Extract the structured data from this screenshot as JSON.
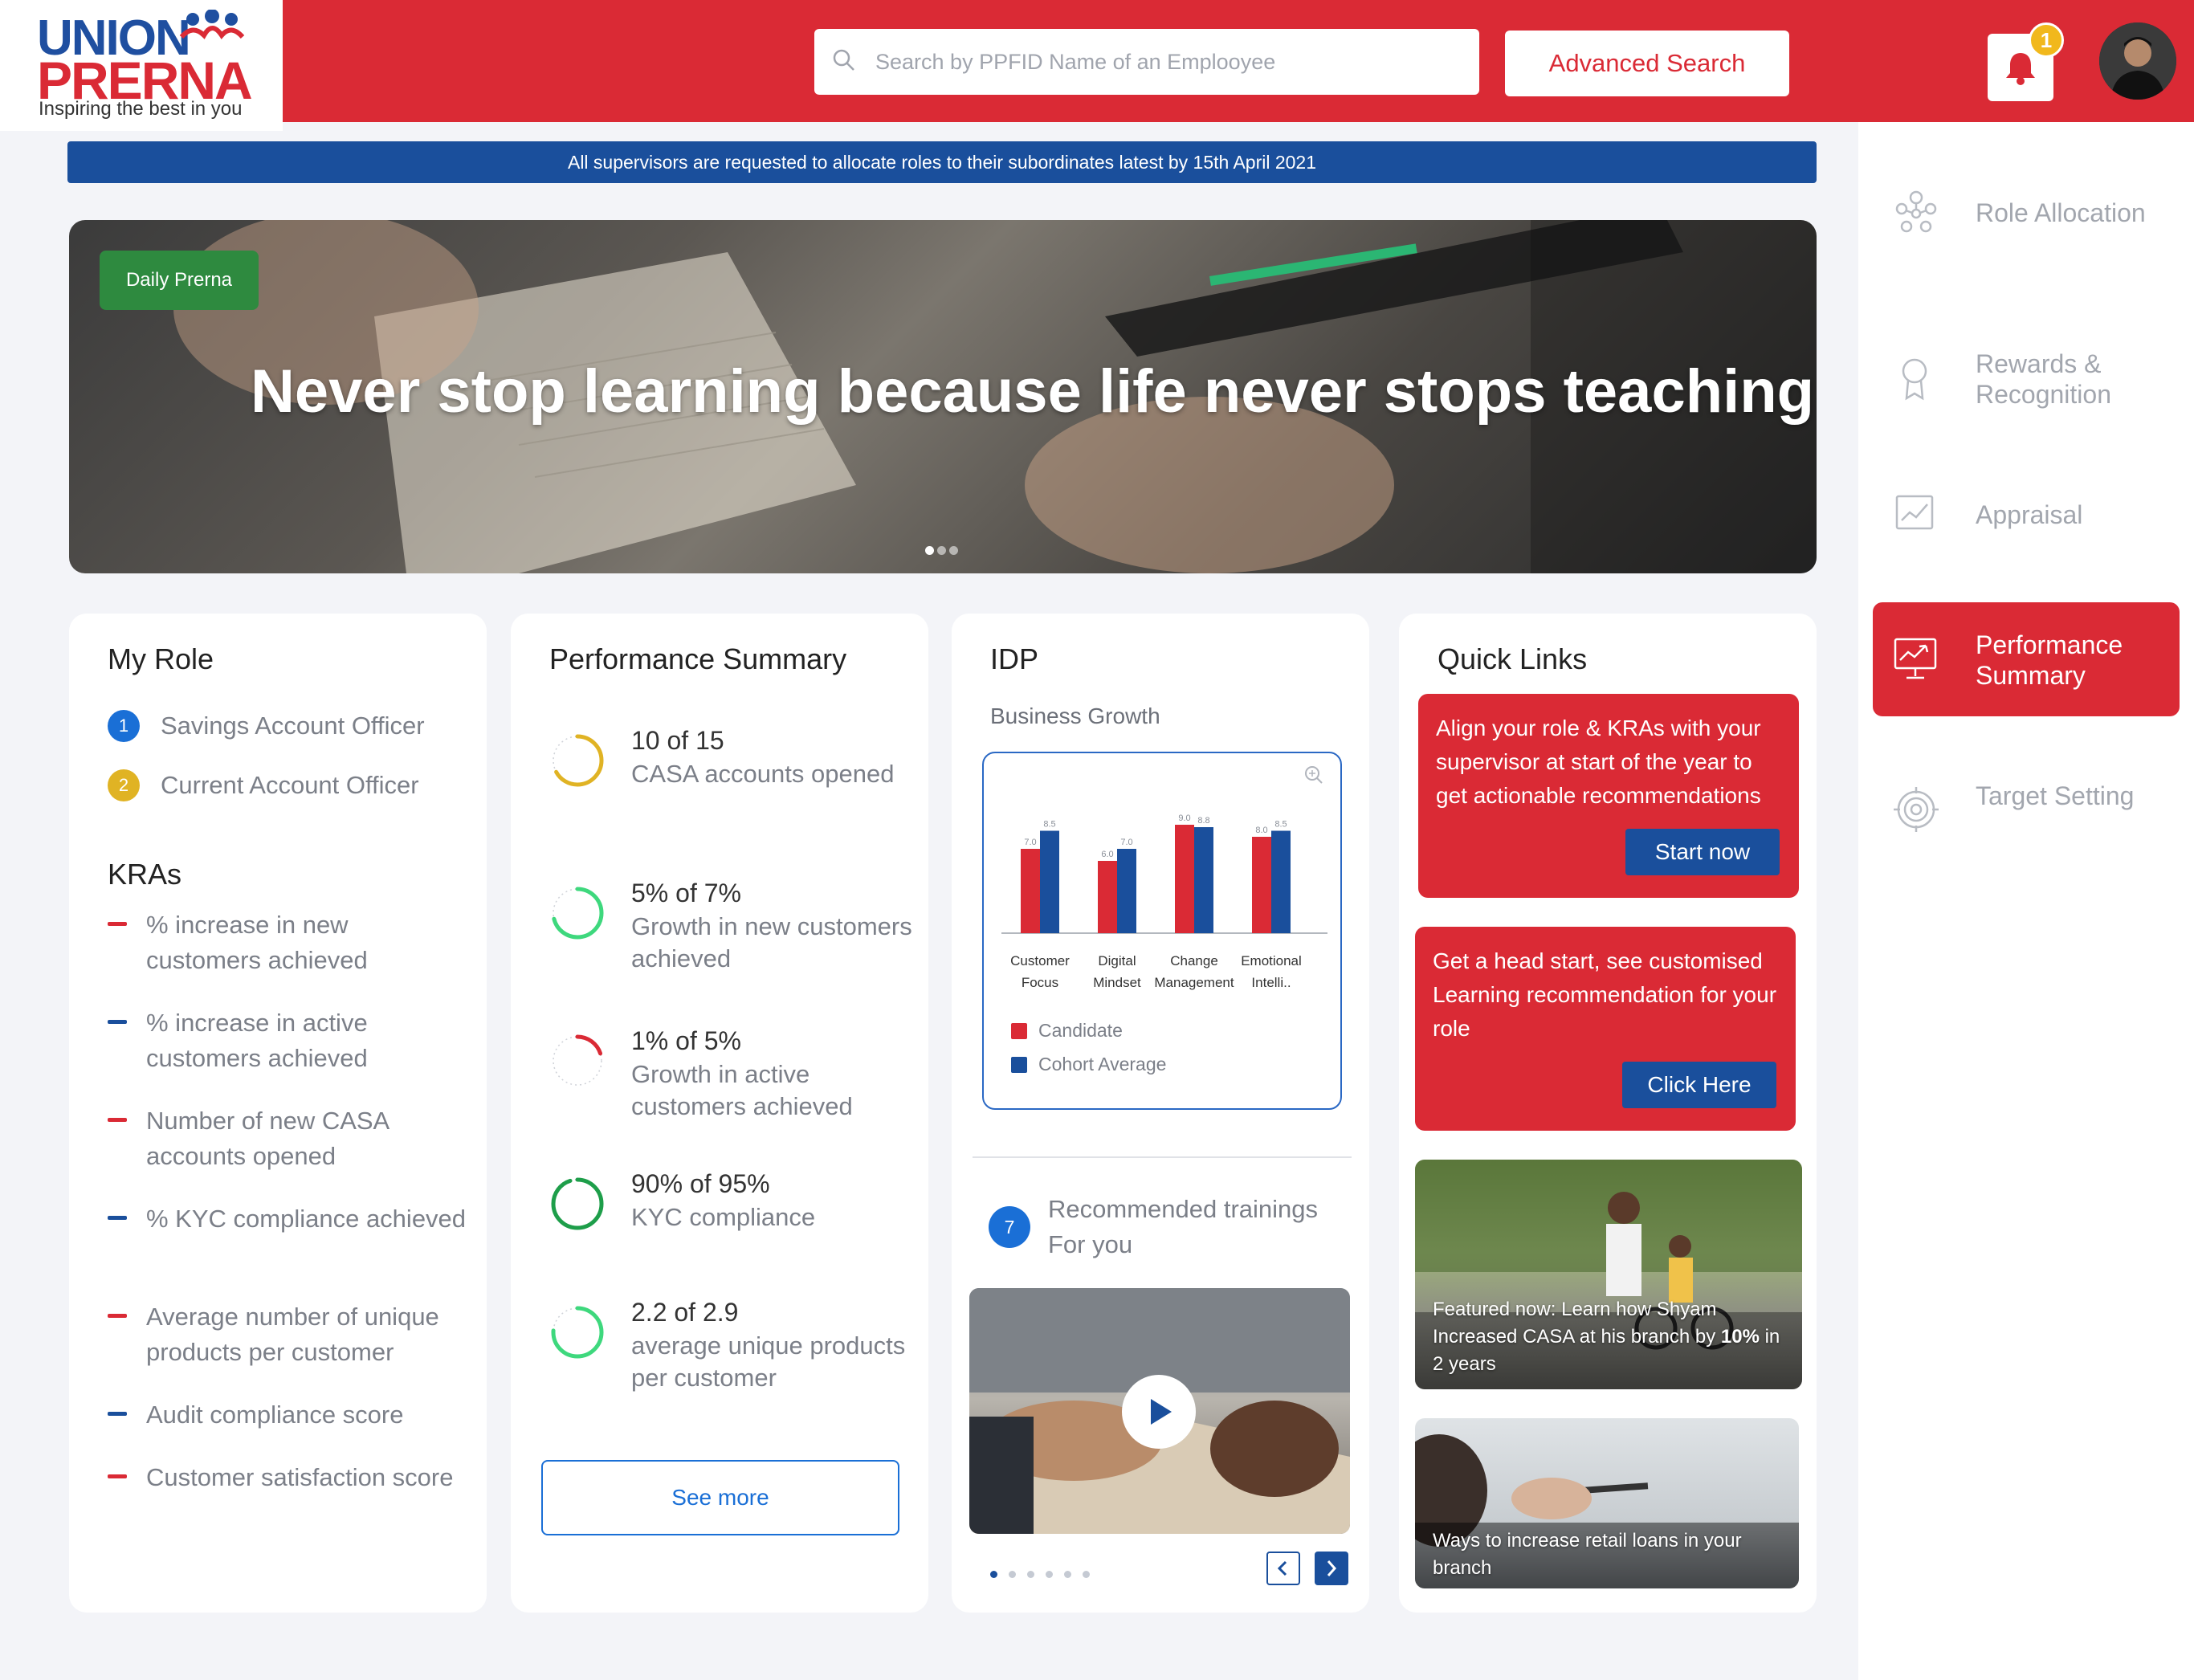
{
  "header": {
    "logo_top": "UNION",
    "logo_bottom": "PRERNA",
    "logo_tagline": "Inspiring the best in you",
    "search_placeholder": "Search by PPFID Name of an Emplooyee",
    "advanced_search_label": "Advanced Search",
    "notification_count": "1",
    "brand_color": "#da2a35",
    "accent_color": "#1a4f9c"
  },
  "notice": "All supervisors are requested to allocate roles to their subordinates latest by 15th April 2021",
  "hero": {
    "badge": "Daily Prerna",
    "quote": "Never stop learning because life never stops teaching",
    "slides": 3,
    "active_slide": 1
  },
  "my_role": {
    "title": "My Role",
    "roles": [
      {
        "num": "1",
        "label": "Savings Account Officer",
        "color": "#1a6fd6"
      },
      {
        "num": "2",
        "label": "Current Account Officer",
        "color": "#e0b324"
      }
    ],
    "kras_title": "KRAs",
    "kras": [
      {
        "text": "% increase in new customers achieved",
        "color": "#da2a35"
      },
      {
        "text": "% increase in active customers achieved",
        "color": "#1a4f9c"
      },
      {
        "text": "Number of new CASA accounts opened",
        "color": "#da2a35"
      },
      {
        "text": "% KYC compliance achieved",
        "color": "#1a4f9c"
      },
      {
        "text": "Average number of unique products per customer",
        "color": "#da2a35"
      },
      {
        "text": "Audit compliance score",
        "color": "#1a4f9c"
      },
      {
        "text": "Customer satisfaction score",
        "color": "#da2a35"
      }
    ]
  },
  "performance_summary": {
    "title": "Performance Summary",
    "items": [
      {
        "main": "10 of 15",
        "sub": "CASA accounts opened",
        "progress": 0.67,
        "color": "#e0b324"
      },
      {
        "main": "5% of 7%",
        "sub": "Growth in new customers achieved",
        "progress": 0.71,
        "color": "#3ed87d"
      },
      {
        "main": "1% of 5%",
        "sub": "Growth in active customers achieved",
        "progress": 0.2,
        "color": "#da2a35"
      },
      {
        "main": "90% of 95%",
        "sub": "KYC compliance",
        "progress": 0.95,
        "color": "#1e9e4a"
      },
      {
        "main": "2.2 of 2.9",
        "sub": "average unique products per customer",
        "progress": 0.76,
        "color": "#3ed87d"
      }
    ],
    "see_more_label": "See more"
  },
  "idp": {
    "title": "IDP",
    "subtitle": "Business Growth",
    "recommended_count": "7",
    "recommended_line1": "Recommended trainings",
    "recommended_line2": "For you",
    "carousel_dots": 6,
    "carousel_active": 0
  },
  "chart_data": {
    "type": "bar",
    "title": "Business Growth",
    "categories": [
      "Customer Focus",
      "Digital Mindset",
      "Change Management",
      "Emotional Intelli.."
    ],
    "category_lines": [
      [
        "Customer",
        "Focus"
      ],
      [
        "Digital",
        "Mindset"
      ],
      [
        "Change",
        "Management"
      ],
      [
        "Emotional",
        "Intelli.."
      ]
    ],
    "series": [
      {
        "name": "Candidate",
        "values": [
          7.0,
          6.0,
          9.0,
          8.0
        ],
        "color": "#da2a35"
      },
      {
        "name": "Cohort Average",
        "values": [
          8.5,
          7.0,
          8.8,
          8.5
        ],
        "color": "#1a4f9c"
      }
    ],
    "ylim": [
      0,
      10
    ],
    "legend": "bottom-left",
    "grid": false
  },
  "quick_links": {
    "title": "Quick Links",
    "cards": [
      {
        "text": "Align your role & KRAs with your supervisor at start of the year to get actionable recommendations",
        "button": "Start now"
      },
      {
        "text": "Get a head start, see customised Learning recommendation for your role",
        "button": "Click Here"
      }
    ],
    "featured": {
      "caption_prefix": "Featured now: Learn how Shyam Increased CASA at his branch by",
      "caption_bold": "10%",
      "caption_suffix": "in 2 years"
    },
    "article": "Ways to increase retail loans in your branch"
  },
  "sidebar": {
    "items": [
      {
        "label": "Role Allocation",
        "icon": "role-allocation-icon"
      },
      {
        "label": "Rewards & Recognition",
        "icon": "award-ribbon-icon"
      },
      {
        "label": "Appraisal",
        "icon": "appraisal-chart-icon"
      },
      {
        "label": "Performance Summary",
        "icon": "performance-monitor-icon",
        "active": true
      },
      {
        "label": "Target Setting",
        "icon": "target-icon"
      }
    ]
  }
}
